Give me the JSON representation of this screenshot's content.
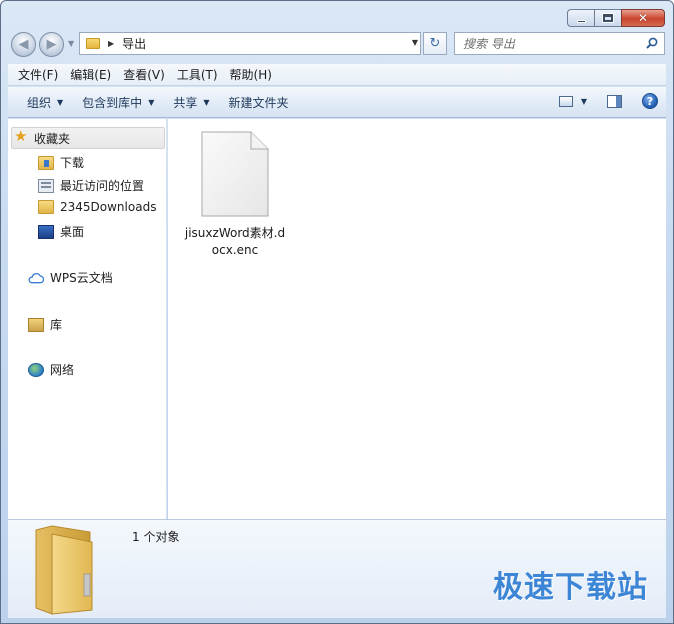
{
  "window": {
    "caption_buttons": [
      "minimize",
      "maximize",
      "close"
    ],
    "close_glyph": "✕"
  },
  "nav": {
    "address_path": "导出",
    "search_placeholder": "搜索 导出",
    "back_glyph": "◀",
    "forward_glyph": "▶",
    "refresh_glyph": "↻"
  },
  "menu": {
    "items": [
      "文件(F)",
      "编辑(E)",
      "查看(V)",
      "工具(T)",
      "帮助(H)"
    ]
  },
  "toolbar": {
    "items": [
      {
        "label": "组织",
        "has_dropdown": true
      },
      {
        "label": "包含到库中",
        "has_dropdown": true
      },
      {
        "label": "共享",
        "has_dropdown": true
      },
      {
        "label": "新建文件夹",
        "has_dropdown": false
      }
    ],
    "help_glyph": "?"
  },
  "sidebar": {
    "favorites_label": "收藏夹",
    "favorites": [
      {
        "label": "下载",
        "icon": "download-folder-icon"
      },
      {
        "label": "最近访问的位置",
        "icon": "recent-places-icon"
      },
      {
        "label": "2345Downloads",
        "icon": "folder-icon"
      },
      {
        "label": "桌面",
        "icon": "desktop-icon"
      }
    ],
    "wps_label": "WPS云文档",
    "library_label": "库",
    "network_label": "网络"
  },
  "content": {
    "files": [
      {
        "name": "jisuxzWord素材.docx.enc",
        "icon": "document-icon"
      }
    ]
  },
  "details": {
    "count_text": "1 个对象"
  },
  "watermark": {
    "text": "极速下载站"
  },
  "colors": {
    "accent": "#3d86d6",
    "close_red": "#c9442f",
    "folder_yellow": "#f7dc85"
  }
}
